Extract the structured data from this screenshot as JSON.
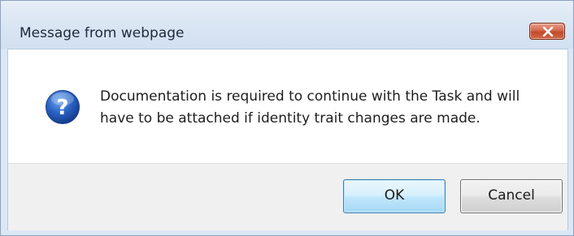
{
  "dialog": {
    "title": "Message from webpage",
    "message_line1": "Documentation is required to continue with the Task and will",
    "message_line2": "have to be attached if identity trait changes are made.",
    "icon": "question-icon",
    "buttons": {
      "ok_label": "OK",
      "cancel_label": "Cancel"
    }
  },
  "colors": {
    "close_button": "#c24a2c",
    "question_icon": "#2a62c4",
    "ok_border": "#3c7fb1"
  }
}
